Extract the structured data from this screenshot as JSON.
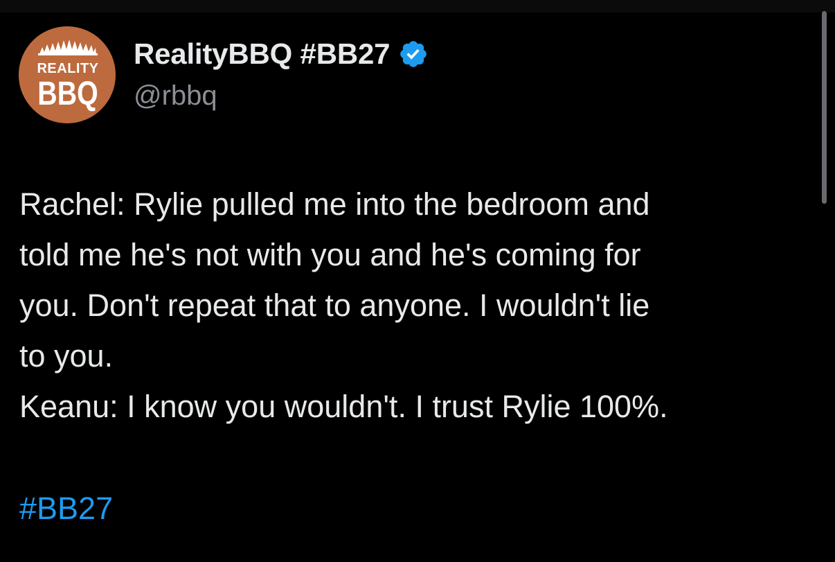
{
  "colors": {
    "background": "#000000",
    "text_primary": "#e7e9ea",
    "text_secondary": "#8b8f94",
    "link": "#1d9bf0",
    "verified_badge": "#1d9bf0",
    "avatar_background": "#bd6a3e"
  },
  "author": {
    "display_name": "RealityBBQ #BB27",
    "handle": "@rbbq",
    "verified": true,
    "verified_icon": "verified-badge-icon",
    "avatar": {
      "icon": "reality-bbq-logo",
      "line1": "REALITY",
      "line2": "BBQ"
    }
  },
  "tweet": {
    "lines": [
      "Rachel: Rylie pulled me into the bedroom and",
      "told me he's not with you and he's coming for",
      "you. Don't repeat that to anyone. I wouldn't lie",
      "to you.",
      "Keanu: I know you wouldn't. I trust Rylie 100%."
    ],
    "hashtag": "#BB27"
  }
}
